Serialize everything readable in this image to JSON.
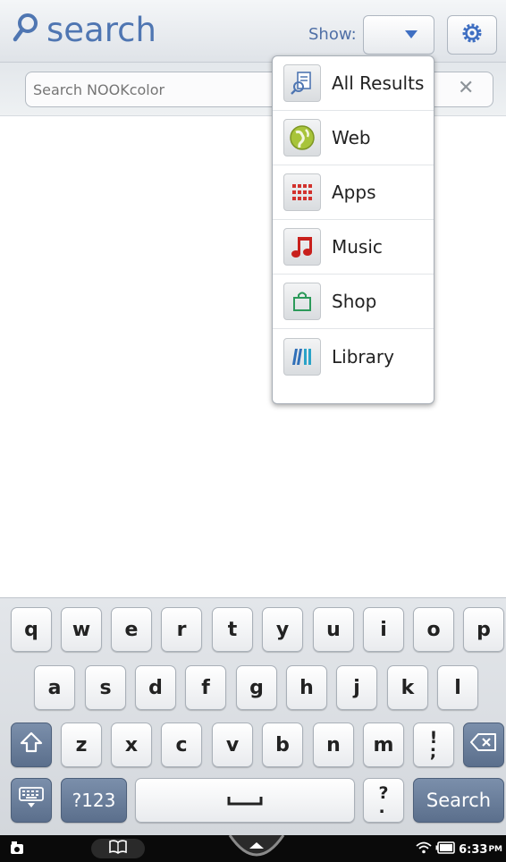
{
  "header": {
    "brand_icon": "search-icon",
    "brand_text": "search",
    "show_label": "Show:",
    "show_value": "",
    "settings_icon": "gear-icon"
  },
  "search": {
    "placeholder": "Search NOOKcolor",
    "value": "",
    "clear_icon": "close-icon"
  },
  "dropdown": {
    "items": [
      {
        "label": "All Results",
        "icon": "all-results-icon"
      },
      {
        "label": "Web",
        "icon": "globe-icon"
      },
      {
        "label": "Apps",
        "icon": "apps-grid-icon"
      },
      {
        "label": "Music",
        "icon": "music-note-icon"
      },
      {
        "label": "Shop",
        "icon": "shopping-bag-icon"
      },
      {
        "label": "Library",
        "icon": "library-books-icon"
      }
    ]
  },
  "keyboard": {
    "row1": [
      "q",
      "w",
      "e",
      "r",
      "t",
      "y",
      "u",
      "i",
      "o",
      "p"
    ],
    "row2": [
      "a",
      "s",
      "d",
      "f",
      "g",
      "h",
      "j",
      "k",
      "l"
    ],
    "row3": [
      "z",
      "x",
      "c",
      "v",
      "b",
      "n",
      "m"
    ],
    "punct_key": "!\n;",
    "question_key": "?\n.",
    "numbers_key": "?123",
    "search_key": "Search",
    "shift_icon": "shift-arrow-icon",
    "backspace_icon": "backspace-icon",
    "hide_keyboard_icon": "keyboard-icon",
    "space_icon": "space-bar-icon"
  },
  "statusbar": {
    "time": "6:33",
    "time_suffix": "PM",
    "left_icon": "camera-icon",
    "book_icon": "open-book-icon",
    "home_icon": "nook-n-icon",
    "wifi_icon": "wifi-icon",
    "battery_icon": "battery-icon"
  },
  "colors": {
    "brand_blue": "#4f76b2",
    "key_dark": "#6a7f9d",
    "status_bar": "#0a0a0a"
  }
}
